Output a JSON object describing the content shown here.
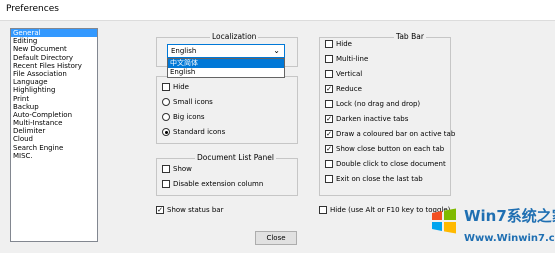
{
  "window": {
    "title": "Preferences"
  },
  "sidebar": {
    "items": [
      "General",
      "Editing",
      "New Document",
      "Default Directory",
      "Recent Files History",
      "File Association",
      "Language",
      "Highlighting",
      "Print",
      "Backup",
      "Auto-Completion",
      "Multi-Instance",
      "Delimiter",
      "Cloud",
      "Search Engine",
      "MISC."
    ],
    "selected": "General"
  },
  "localization": {
    "title": "Localization",
    "selected_value": "English",
    "options": [
      "中文简体",
      "English"
    ],
    "highlighted": "中文简体"
  },
  "toolbar": {
    "title": "Toolbar",
    "hide_label": "Hide",
    "hide_checked": false,
    "radio_labels": [
      "Small icons",
      "Big icons",
      "Standard icons"
    ],
    "radio_selected": "Standard icons"
  },
  "doclist": {
    "title": "Document List Panel",
    "show_label": "Show",
    "show_checked": false,
    "disable_ext_label": "Disable extension column",
    "disable_ext_checked": false
  },
  "status_bar": {
    "label": "Show status bar",
    "checked": true
  },
  "tabbar": {
    "title": "Tab Bar",
    "options": [
      {
        "label": "Hide",
        "checked": false
      },
      {
        "label": "Multi-line",
        "checked": false
      },
      {
        "label": "Vertical",
        "checked": false
      },
      {
        "label": "Reduce",
        "checked": true
      },
      {
        "label": "Lock (no drag and drop)",
        "checked": false
      },
      {
        "label": "Darken inactive tabs",
        "checked": true
      },
      {
        "label": "Draw a coloured bar on active tab",
        "checked": true
      },
      {
        "label": "Show close button on each tab",
        "checked": true
      },
      {
        "label": "Double click to close document",
        "checked": false
      },
      {
        "label": "Exit on close the last tab",
        "checked": false
      }
    ]
  },
  "menubar": {
    "label": "Hide (use Alt or F10 key to toggle)",
    "checked": false
  },
  "buttons": {
    "close": "Close"
  },
  "watermark": {
    "line1": "Win7系统之家",
    "line2": "Www.Winwin7.com"
  }
}
